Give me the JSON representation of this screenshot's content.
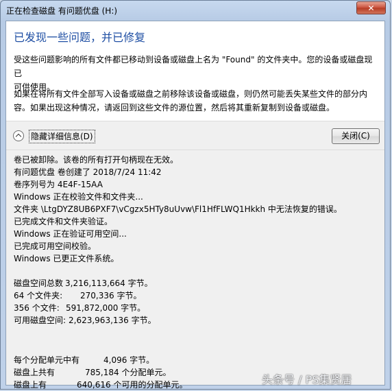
{
  "window": {
    "title": "正在检查磁盘 有问题优盘 (H:)",
    "close_label": "✕"
  },
  "message": {
    "heading": "已发现一些问题，并已修复",
    "para1_line1": "受这些问题影响的所有文件都已移动到设备或磁盘上名为 \"Found\" 的文件夹中。您的设备或磁盘现已",
    "para1_line2": "可供使用。",
    "para2_line1": "如果在将所有文件全部写入设备或磁盘之前移除该设备或磁盘，则仍然可能丢失某些文件的部分内",
    "para2_line2": "容。如果出现这种情况，请返回到这些文件的源位置，然后将其重新复制到设备或磁盘。"
  },
  "controls": {
    "toggle_label": "隐藏详细信息(D)",
    "close_button": "关闭(C)"
  },
  "details": {
    "log": [
      "卷已被卸除。该卷的所有打开句柄现在无效。",
      "有问题优盘 卷创建了 2018/7/24 11:42",
      "卷序列号为 4E4F-15AA",
      "Windows 正在校验文件和文件夹...",
      "文件夹 \\LtgDYZ8UB6PXF7\\vCgzx5HTy8uUvw\\Fl1HfFLWQ1Hkkh 中无法恢复的错误。",
      "已完成文件和文件夹验证。",
      "Windows 正在验证可用空间...",
      "已完成可用空间校验。",
      "Windows 已更正文件系统。"
    ],
    "stats": [
      {
        "label": "磁盘空间总数",
        "value": "3,216,113,664 字节。"
      },
      {
        "label": "64 个文件夹:",
        "value": "270,336 字节。"
      },
      {
        "label": "356 个文件:",
        "value": "591,872,000 字节。"
      },
      {
        "label": "可用磁盘空间:",
        "value": "2,623,963,136 字节。"
      }
    ],
    "units": [
      {
        "label": "每个分配单元中有",
        "value": "4,096 字节。"
      },
      {
        "label": "磁盘上共有",
        "value": "785,184 个分配单元。"
      },
      {
        "label": "磁盘上有",
        "value": "640,616 个可用的分配单元。"
      }
    ]
  },
  "watermark": "头条号 / PS集贤居"
}
